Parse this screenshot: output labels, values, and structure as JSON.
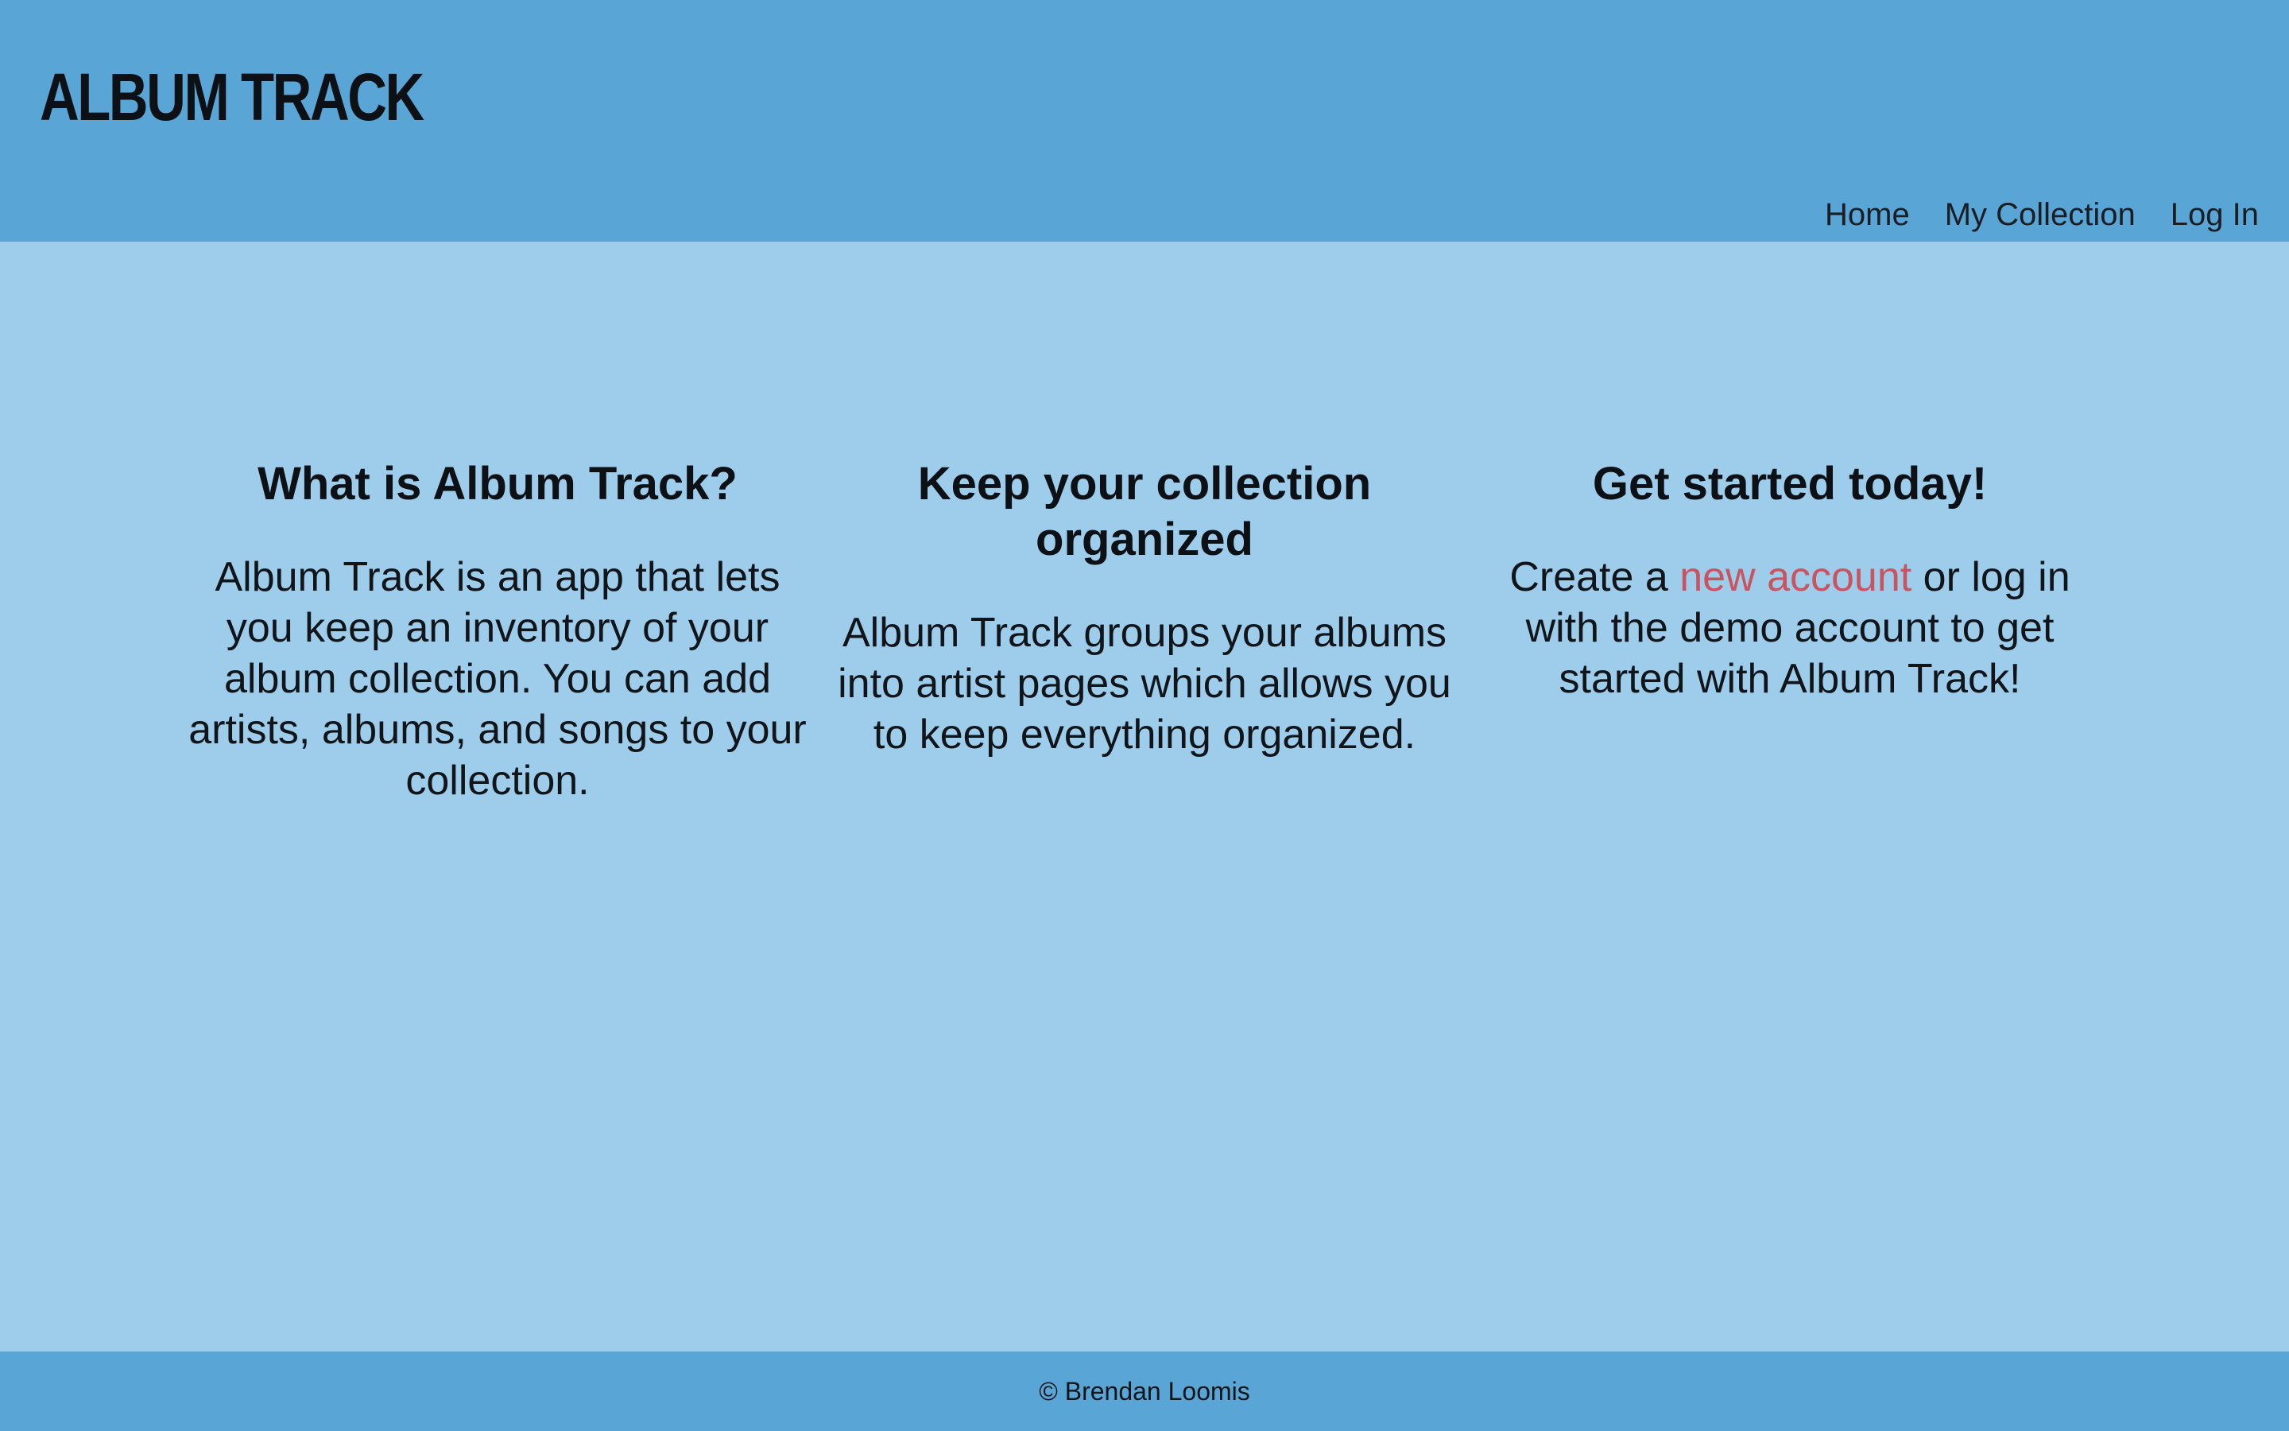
{
  "header": {
    "logo": "ALBUM TRACK",
    "nav": [
      {
        "label": "Home"
      },
      {
        "label": "My Collection"
      },
      {
        "label": "Log In"
      }
    ]
  },
  "main": {
    "columns": [
      {
        "heading": "What is Album Track?",
        "body": "Album Track is an app that lets you keep an inventory of your album collection. You can add artists, albums, and songs to your collection."
      },
      {
        "heading": "Keep your collection organized",
        "body": "Album Track groups your albums into artist pages which allows you to keep everything organized."
      },
      {
        "heading": "Get started today!",
        "body_prefix": "Create a ",
        "link_label": "new account",
        "body_suffix": " or log in with the demo account to get started with Album Track!"
      }
    ]
  },
  "footer": {
    "text": "© Brendan Loomis"
  },
  "colors": {
    "header_bg": "#59a6d6",
    "page_bg": "#9dcdeb",
    "link": "#c9545f"
  }
}
